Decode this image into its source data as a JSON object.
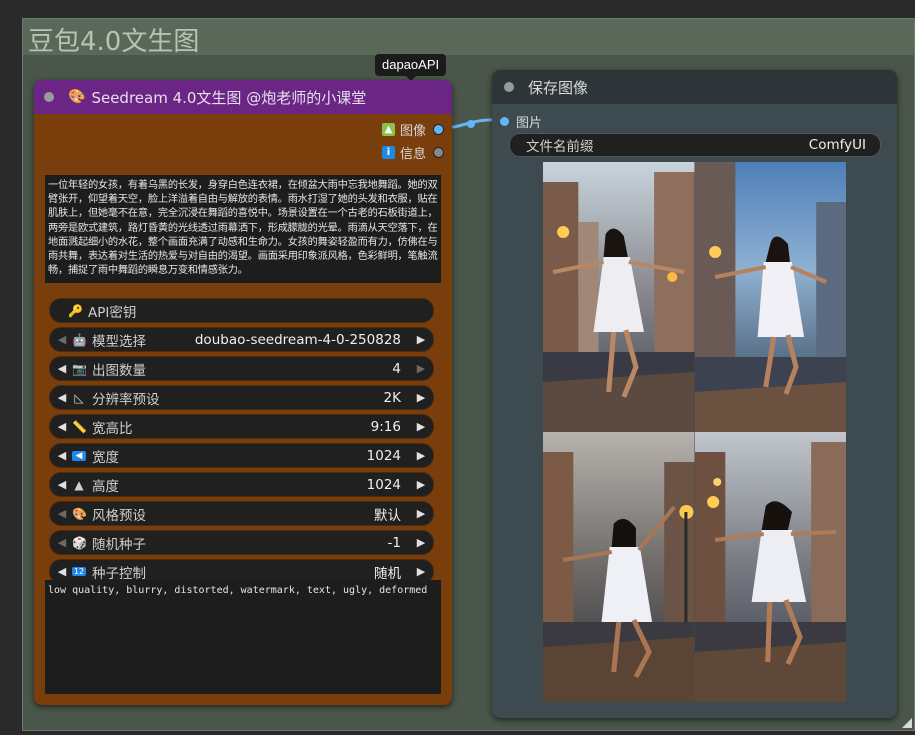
{
  "group": {
    "title": "豆包4.0文生图"
  },
  "badge": {
    "label": "dapaoAPI"
  },
  "seedream_node": {
    "title": "Seedream 4.0文生图 @炮老师的小课堂",
    "title_icon": "palette-icon",
    "outputs": [
      {
        "label": "图像",
        "icon": "image-icon",
        "port_color": "#64b5f6"
      },
      {
        "label": "信息",
        "icon": "info-icon",
        "port_color": "#888888"
      }
    ],
    "prompt": "一位年轻的女孩，有着乌黑的长发，身穿白色连衣裙，在倾盆大雨中忘我地舞蹈。她的双臂张开，仰望着天空，脸上洋溢着自由与解放的表情。雨水打湿了她的头发和衣服，贴在肌肤上，但她毫不在意，完全沉浸在舞蹈的喜悦中。场景设置在一个古老的石板街道上，两旁是欧式建筑，路灯昏黄的光线透过雨幕洒下，形成朦胧的光晕。雨滴从天空落下，在地面溅起细小的水花，整个画面充满了动感和生命力。女孩的舞姿轻盈而有力，仿佛在与雨共舞，表达着对生活的热爱与对自由的渴望。画面采用印象派风格，色彩鲜明，笔触流畅，捕捉了雨中舞蹈的瞬息万变和情感张力。",
    "widgets": [
      {
        "label": "API密钥",
        "icon": "key-icon",
        "value": "",
        "type": "button"
      },
      {
        "label": "模型选择",
        "icon": "robot-icon",
        "value": "doubao-seedream-4-0-250828",
        "left_enabled": false,
        "right_enabled": true
      },
      {
        "label": "出图数量",
        "icon": "camera-icon",
        "value": "4",
        "left_enabled": true,
        "right_enabled": false
      },
      {
        "label": "分辨率预设",
        "icon": "triangle-ruler-icon",
        "value": "2K",
        "left_enabled": true,
        "right_enabled": true
      },
      {
        "label": "宽高比",
        "icon": "ruler-icon",
        "value": "9:16",
        "left_enabled": true,
        "right_enabled": true
      },
      {
        "label": "宽度",
        "icon": "arrow-left-box-icon",
        "value": "1024",
        "left_enabled": true,
        "right_enabled": true
      },
      {
        "label": "高度",
        "icon": "up-triangle-icon",
        "value": "1024",
        "left_enabled": true,
        "right_enabled": true
      },
      {
        "label": "风格预设",
        "icon": "palette-icon",
        "value": "默认",
        "left_enabled": false,
        "right_enabled": true
      },
      {
        "label": "随机种子",
        "icon": "dice-icon",
        "value": "-1",
        "left_enabled": false,
        "right_enabled": true
      },
      {
        "label": "种子控制",
        "icon": "numbers-icon",
        "value": "随机",
        "left_enabled": true,
        "right_enabled": true
      }
    ],
    "negative_prompt": "low quality, blurry, distorted, watermark, text, ugly, deformed"
  },
  "save_node": {
    "title": "保存图像",
    "input_label": "图片",
    "prefix_label": "文件名前缀",
    "prefix_value": "ComfyUI"
  },
  "colors": {
    "seedream_title_bg": "#6b2585",
    "seedream_body_bg": "#7a3d0c",
    "save_title_bg": "#2d3539",
    "save_body_bg": "#3d4a50",
    "wire": "#64b5f6",
    "group_bg": "#4e5a4d"
  }
}
